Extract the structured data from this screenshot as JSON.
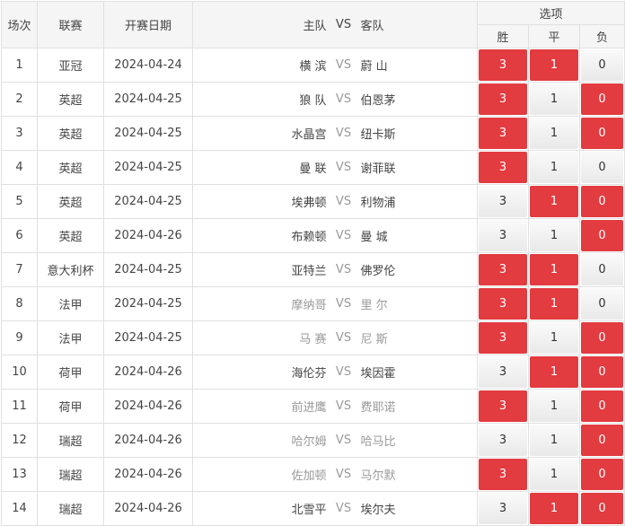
{
  "header": {
    "round": "场次",
    "league": "联赛",
    "date": "开赛日期",
    "home": "主队",
    "vs": "VS",
    "away": "客队",
    "options": "选项",
    "win": "胜",
    "draw": "平",
    "lose": "负"
  },
  "colors": {
    "selected": "#e23b40",
    "muted_text": "#999999"
  },
  "rows": [
    {
      "no": "1",
      "league": "亚冠",
      "date": "2024-04-24",
      "home": "横 滨",
      "away": "蔚 山",
      "muted": false,
      "win": "3",
      "draw": "1",
      "lose": "0",
      "win_sel": true,
      "draw_sel": true,
      "lose_sel": false
    },
    {
      "no": "2",
      "league": "英超",
      "date": "2024-04-25",
      "home": "狼 队",
      "away": "伯恩茅",
      "muted": false,
      "win": "3",
      "draw": "1",
      "lose": "0",
      "win_sel": true,
      "draw_sel": false,
      "lose_sel": true
    },
    {
      "no": "3",
      "league": "英超",
      "date": "2024-04-25",
      "home": "水晶宫",
      "away": "纽卡斯",
      "muted": false,
      "win": "3",
      "draw": "1",
      "lose": "0",
      "win_sel": true,
      "draw_sel": false,
      "lose_sel": true
    },
    {
      "no": "4",
      "league": "英超",
      "date": "2024-04-25",
      "home": "曼 联",
      "away": "谢菲联",
      "muted": false,
      "win": "3",
      "draw": "1",
      "lose": "0",
      "win_sel": true,
      "draw_sel": false,
      "lose_sel": false
    },
    {
      "no": "5",
      "league": "英超",
      "date": "2024-04-25",
      "home": "埃弗顿",
      "away": "利物浦",
      "muted": false,
      "win": "3",
      "draw": "1",
      "lose": "0",
      "win_sel": false,
      "draw_sel": true,
      "lose_sel": true
    },
    {
      "no": "6",
      "league": "英超",
      "date": "2024-04-26",
      "home": "布赖顿",
      "away": "曼 城",
      "muted": false,
      "win": "3",
      "draw": "1",
      "lose": "0",
      "win_sel": false,
      "draw_sel": false,
      "lose_sel": true
    },
    {
      "no": "7",
      "league": "意大利杯",
      "date": "2024-04-25",
      "home": "亚特兰",
      "away": "佛罗伦",
      "muted": false,
      "win": "3",
      "draw": "1",
      "lose": "0",
      "win_sel": true,
      "draw_sel": true,
      "lose_sel": false
    },
    {
      "no": "8",
      "league": "法甲",
      "date": "2024-04-25",
      "home": "摩纳哥",
      "away": "里 尔",
      "muted": true,
      "win": "3",
      "draw": "1",
      "lose": "0",
      "win_sel": true,
      "draw_sel": true,
      "lose_sel": false
    },
    {
      "no": "9",
      "league": "法甲",
      "date": "2024-04-25",
      "home": "马 赛",
      "away": "尼 斯",
      "muted": true,
      "win": "3",
      "draw": "1",
      "lose": "0",
      "win_sel": true,
      "draw_sel": false,
      "lose_sel": true
    },
    {
      "no": "10",
      "league": "荷甲",
      "date": "2024-04-26",
      "home": "海伦芬",
      "away": "埃因霍",
      "muted": false,
      "win": "3",
      "draw": "1",
      "lose": "0",
      "win_sel": false,
      "draw_sel": true,
      "lose_sel": true
    },
    {
      "no": "11",
      "league": "荷甲",
      "date": "2024-04-26",
      "home": "前进鹰",
      "away": "费耶诺",
      "muted": true,
      "win": "3",
      "draw": "1",
      "lose": "0",
      "win_sel": true,
      "draw_sel": false,
      "lose_sel": true
    },
    {
      "no": "12",
      "league": "瑞超",
      "date": "2024-04-26",
      "home": "哈尔姆",
      "away": "哈马比",
      "muted": true,
      "win": "3",
      "draw": "1",
      "lose": "0",
      "win_sel": false,
      "draw_sel": false,
      "lose_sel": true
    },
    {
      "no": "13",
      "league": "瑞超",
      "date": "2024-04-26",
      "home": "佐加顿",
      "away": "马尔默",
      "muted": true,
      "win": "3",
      "draw": "1",
      "lose": "0",
      "win_sel": true,
      "draw_sel": false,
      "lose_sel": true
    },
    {
      "no": "14",
      "league": "瑞超",
      "date": "2024-04-26",
      "home": "北雪平",
      "away": "埃尔夫",
      "muted": false,
      "win": "3",
      "draw": "1",
      "lose": "0",
      "win_sel": false,
      "draw_sel": true,
      "lose_sel": true
    }
  ]
}
